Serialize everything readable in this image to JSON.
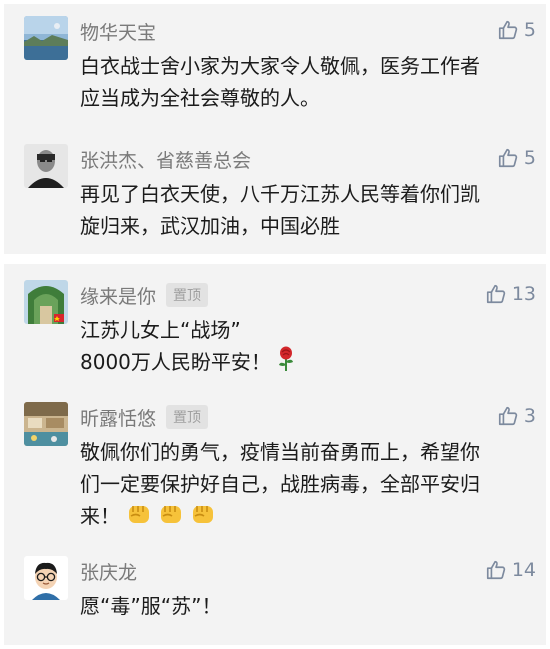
{
  "comments_top": [
    {
      "name": "物华天宝",
      "likes": "5",
      "lines": [
        "白衣战士舍小家为大家令人敬佩，医务工作者",
        "应当成为全社会尊敬的人。"
      ]
    },
    {
      "name": "张洪杰、省慈善总会",
      "likes": "5",
      "lines": [
        "再见了白衣天使，八千万江苏人民等着你们凯",
        "旋归来，武汉加油，中国必胜"
      ]
    }
  ],
  "comments_bottom": [
    {
      "name": "缘来是你",
      "badge": "置顶",
      "likes": "13",
      "lines": [
        "江苏儿女上“战场”",
        "8000万人民盼平安！"
      ],
      "emoji": "rose-icon"
    },
    {
      "name": "昕露恬悠",
      "badge": "置顶",
      "likes": "3",
      "lines": [
        "敬佩你们的勇气，疫情当前奋勇而上，希望你",
        "们一定要保护好自己，战胜病毒，全部平安归",
        "来！"
      ],
      "emoji": "fist-icon"
    },
    {
      "name": "张庆龙",
      "likes": "14",
      "lines": [
        "愿“毒”服“苏”！"
      ]
    }
  ],
  "colors": {
    "panel_bg": "#f3f3f3",
    "name": "#7a7a7a",
    "text": "#1b1b1b",
    "like": "#7d8a9e"
  }
}
